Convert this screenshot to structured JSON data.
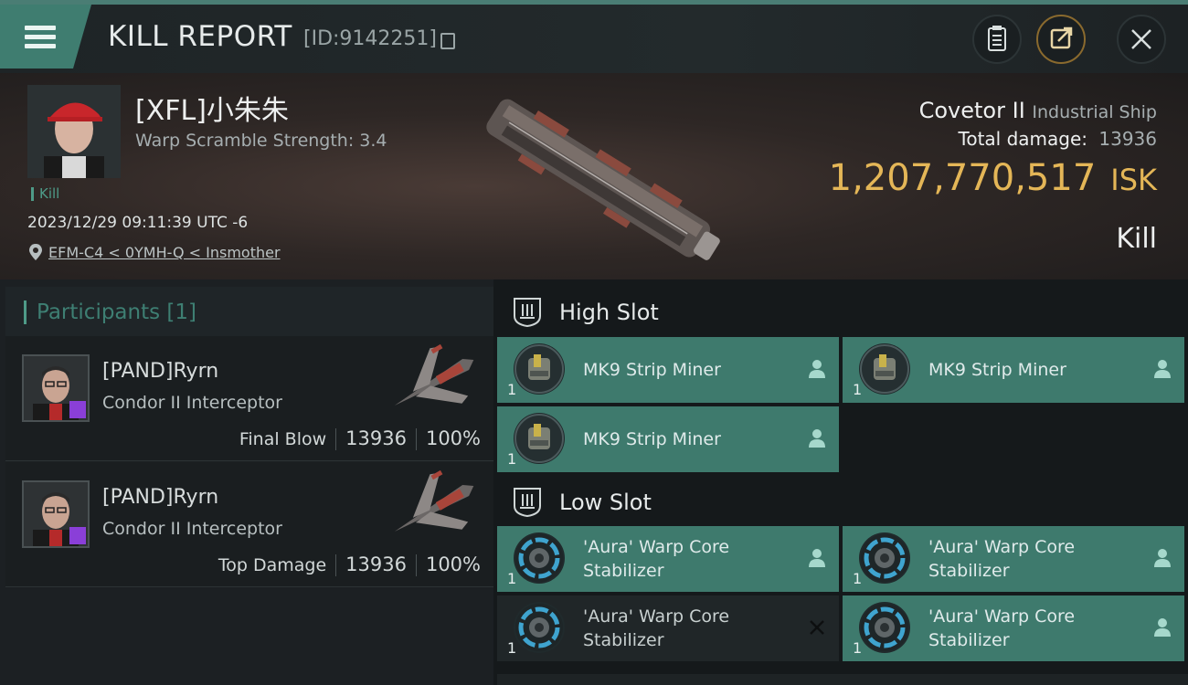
{
  "header": {
    "title": "KILL REPORT",
    "report_id": "[ID:9142251]"
  },
  "victim": {
    "name": "[XFL]小朱朱",
    "warp_scramble": "Warp Scramble Strength: 3.4",
    "tag": "Kill",
    "timestamp": "2023/12/29 09:11:39 UTC -6",
    "location": "EFM-C4 < 0YMH-Q < Insmother",
    "ship": "Covetor II",
    "ship_class": "Industrial Ship",
    "total_damage_label": "Total damage:",
    "total_damage": "13936",
    "isk_value": "1,207,770,517",
    "isk_unit": "ISK",
    "result": "Kill"
  },
  "participants": {
    "label": "Participants [1]",
    "rows": [
      {
        "name": "[PAND]Ryrn",
        "ship": "Condor II Interceptor",
        "role": "Final Blow",
        "damage": "13936",
        "percent": "100%"
      },
      {
        "name": "[PAND]Ryrn",
        "ship": "Condor II Interceptor",
        "role": "Top Damage",
        "damage": "13936",
        "percent": "100%"
      }
    ]
  },
  "slots": {
    "high": {
      "label": "High Slot",
      "modules": [
        {
          "name": "MK9 Strip Miner",
          "qty": "1",
          "status": "dropped"
        },
        {
          "name": "MK9 Strip Miner",
          "qty": "1",
          "status": "dropped"
        },
        {
          "name": "MK9 Strip Miner",
          "qty": "1",
          "status": "dropped"
        }
      ]
    },
    "low": {
      "label": "Low Slot",
      "modules": [
        {
          "name_line1": "'Aura' Warp Core",
          "name_line2": "Stabilizer",
          "qty": "1",
          "status": "dropped"
        },
        {
          "name_line1": "'Aura' Warp Core",
          "name_line2": "Stabilizer",
          "qty": "1",
          "status": "dropped"
        },
        {
          "name_line1": "'Aura' Warp Core",
          "name_line2": "Stabilizer",
          "qty": "1",
          "status": "destroyed"
        },
        {
          "name_line1": "'Aura' Warp Core",
          "name_line2": "Stabilizer",
          "qty": "1",
          "status": "dropped"
        }
      ]
    }
  },
  "colors": {
    "accent": "#3e7a6d",
    "isk_gold": "#e4b657",
    "corp_badge": "#8a3fd8"
  },
  "icons": [
    "menu-icon",
    "copy-icon",
    "clipboard-icon",
    "share-icon",
    "close-icon",
    "location-pin-icon",
    "slot-icon",
    "person-icon",
    "x-icon"
  ]
}
